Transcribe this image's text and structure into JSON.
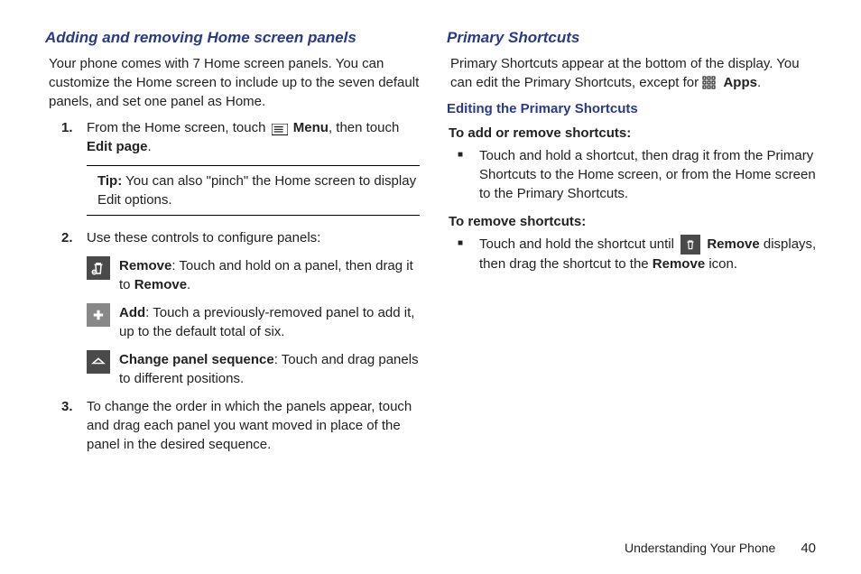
{
  "left": {
    "heading": "Adding and removing Home screen panels",
    "intro": "Your phone comes with 7 Home screen panels. You can customize the Home screen to include up to the seven default panels, and set one panel as Home.",
    "step1_a": "From the Home screen, touch ",
    "step1_menu": "Menu",
    "step1_b": ", then touch ",
    "step1_edit": "Edit page",
    "step1_c": ".",
    "tip_label": "Tip:",
    "tip_text": "You can also \"pinch\" the Home screen to display Edit options.",
    "step2": "Use these controls to configure panels:",
    "remove_label": "Remove",
    "remove_text": ": Touch and hold on a panel, then drag it to ",
    "remove_bold2": "Remove",
    "remove_text2": ".",
    "add_label": "Add",
    "add_text": ": Touch a previously-removed panel to add it, up to the default total of six.",
    "change_label": "Change panel sequence",
    "change_text": ": Touch and drag panels to different positions.",
    "step3": "To change the order in which the panels appear, touch and drag each panel you want moved in place of the panel in the desired sequence."
  },
  "right": {
    "heading": "Primary Shortcuts",
    "intro_a": "Primary Shortcuts appear at the bottom of the display. You can edit the Primary Shortcuts, except for ",
    "intro_apps": "Apps",
    "intro_c": ".",
    "sub": "Editing the Primary Shortcuts",
    "add_remove_h": "To add or remove shortcuts:",
    "add_remove_t": "Touch and hold a shortcut, then drag it from the Primary Shortcuts to the Home screen, or from the Home screen to the Primary Shortcuts.",
    "remove_h": "To remove shortcuts:",
    "remove_t1": "Touch and hold the shortcut until ",
    "remove_bold": "Remove",
    "remove_t2": " displays, then drag the shortcut to the ",
    "remove_bold2": "Remove",
    "remove_t3": " icon."
  },
  "footer": {
    "chapter": "Understanding Your Phone",
    "page": "40"
  }
}
